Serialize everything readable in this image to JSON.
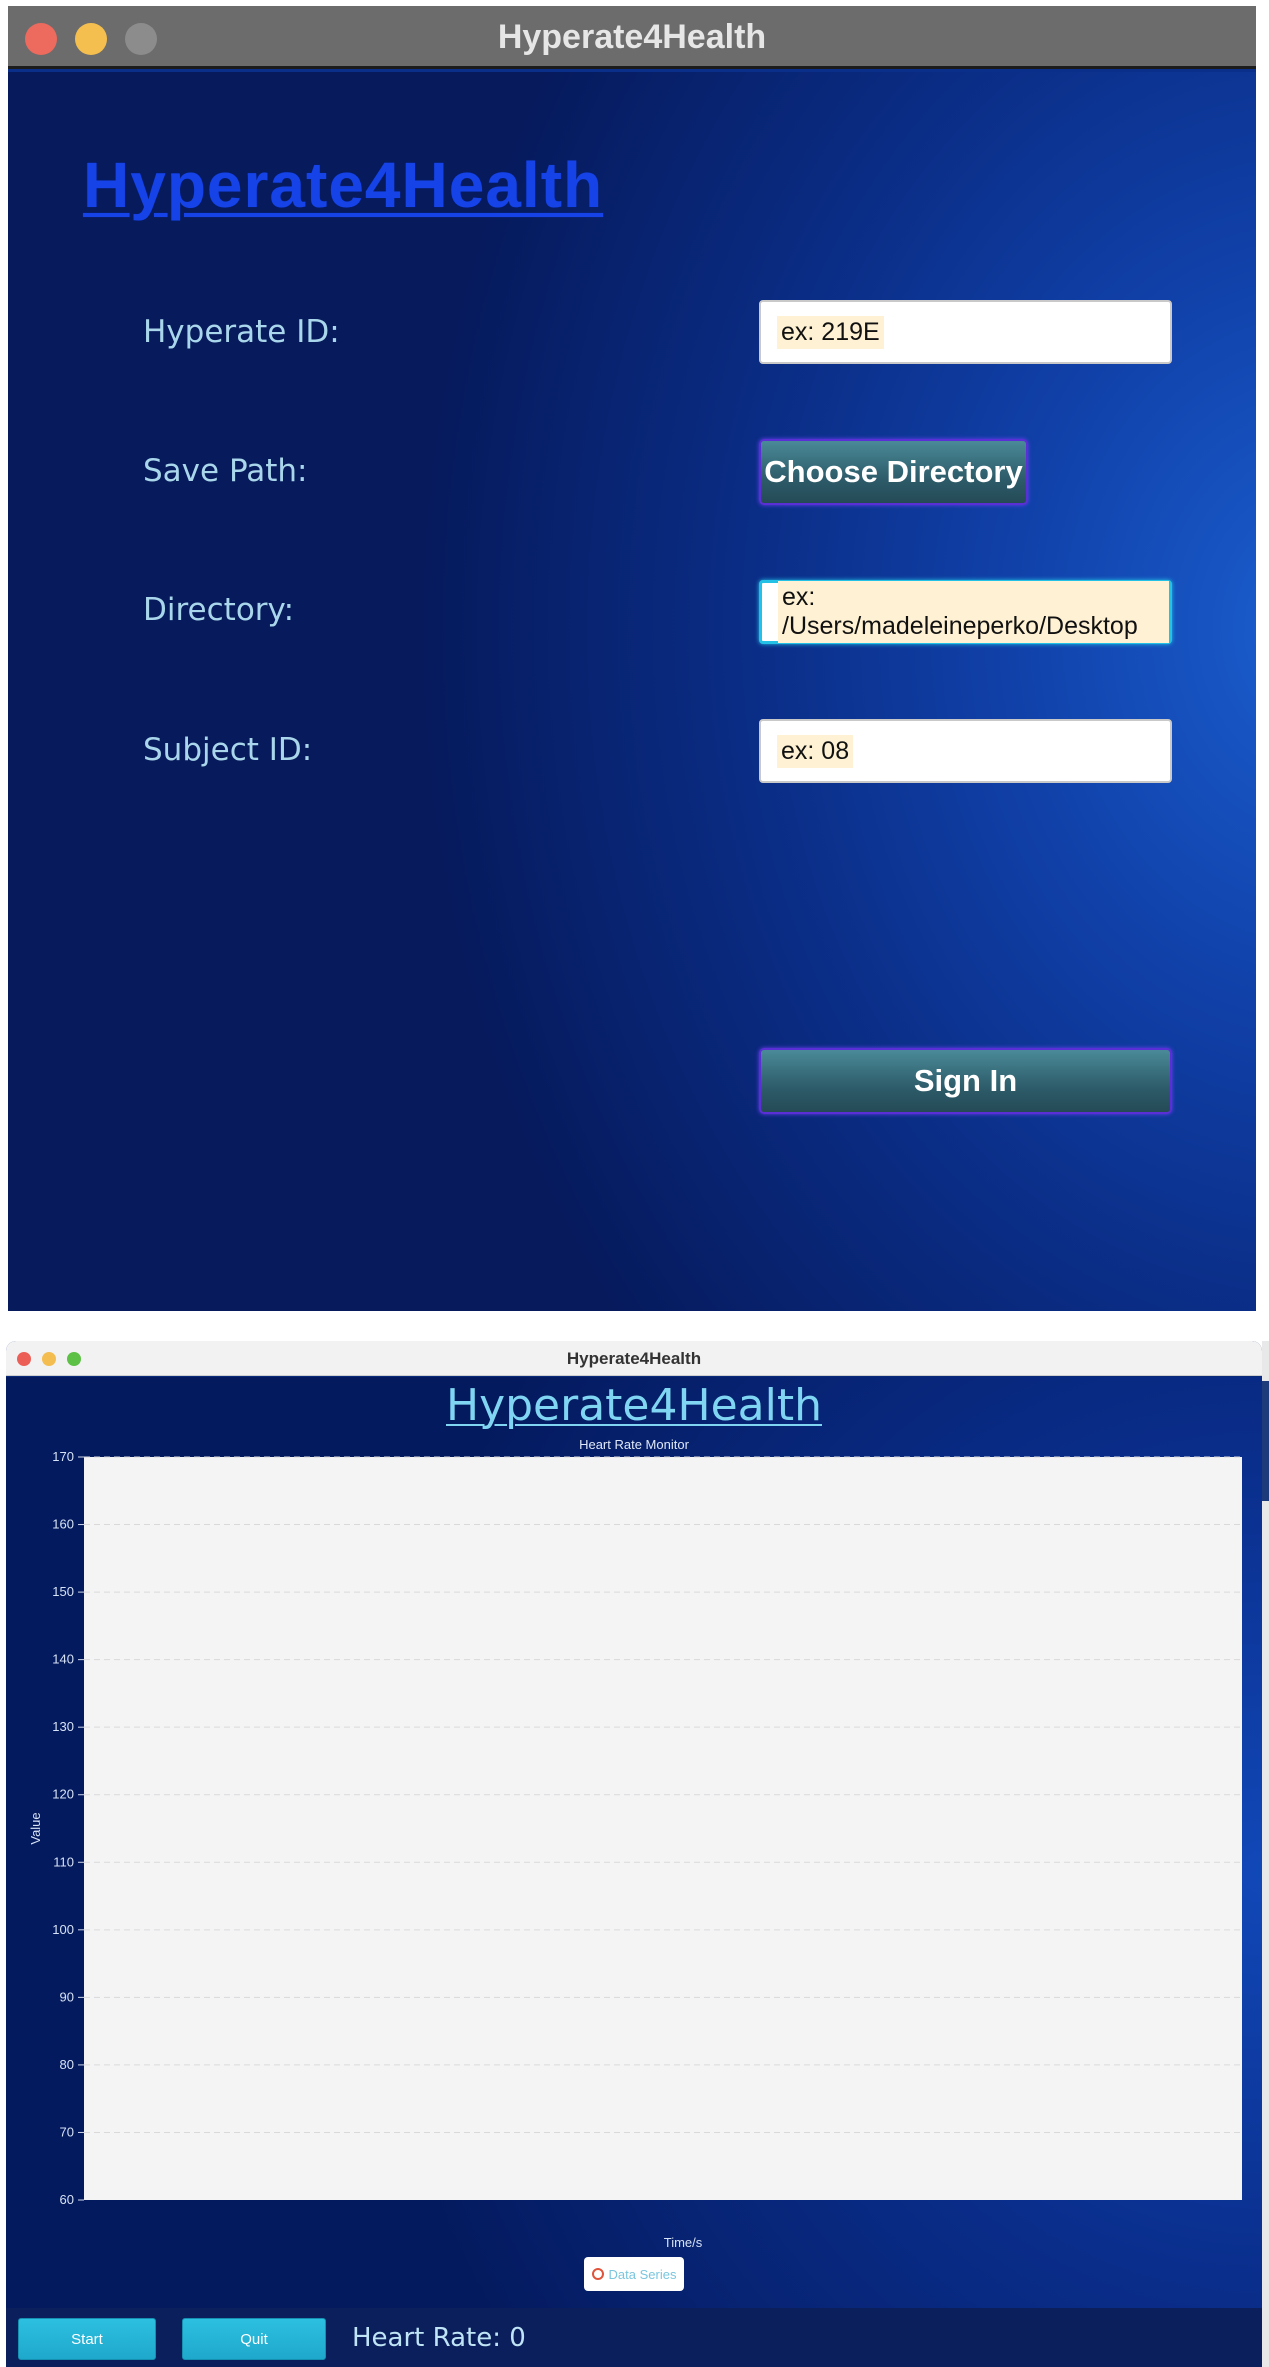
{
  "sign_in_window": {
    "title": "Hyperate4Health",
    "logo": "Hyperate4Health",
    "hyperate_id": {
      "label": "Hyperate ID:",
      "placeholder": "ex: 219E"
    },
    "save_path": {
      "label": "Save Path:",
      "button": "Choose Directory"
    },
    "directory": {
      "label": "Directory:",
      "placeholder": "ex: /Users/madeleineperko/Desktop"
    },
    "subject_id": {
      "label": "Subject ID:",
      "placeholder": "ex: 08"
    },
    "sign_in_button": "Sign In",
    "colors": {
      "background": "#0a2f8a",
      "logo": "#1543e8",
      "label": "#a9d6ea",
      "button": "#2e5c6a"
    }
  },
  "monitor_window": {
    "title": "Hyperate4Health",
    "app_title": "Hyperate4Health",
    "start_button": "Start",
    "quit_button": "Quit",
    "heart_rate_label": "Heart Rate: 0",
    "colors": {
      "app_title": "#7fd5f2",
      "button": "#1ea8cc",
      "legend_marker": "#e0543c"
    }
  },
  "chart_data": {
    "type": "line",
    "title": "Heart Rate Monitor",
    "xlabel": "Time/s",
    "ylabel": "Value",
    "ylim": [
      60,
      170
    ],
    "yticks": [
      60,
      70,
      80,
      90,
      100,
      110,
      120,
      130,
      140,
      150,
      160,
      170
    ],
    "grid": true,
    "legend_position": "bottom-center",
    "series": [
      {
        "name": "Data Series",
        "x": [],
        "y": []
      }
    ]
  }
}
